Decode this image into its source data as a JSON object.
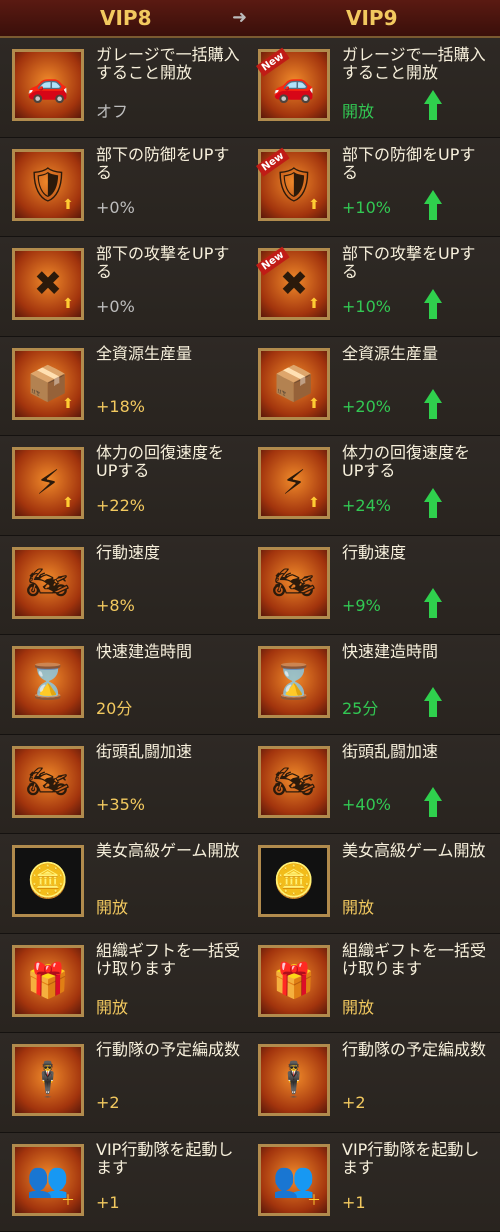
{
  "header": {
    "left_label": "VIP8",
    "arrow_icon": "arrow-right-icon",
    "right_label": "VIP9"
  },
  "rows": [
    {
      "title": "ガレージで一括購入すること開放",
      "icon": "car-icon",
      "left_value": "オフ",
      "right_value": "開放",
      "right_new": "New",
      "increase": true
    },
    {
      "title": "部下の防御をUPする",
      "icon": "shield-icon",
      "left_value": "+0%",
      "right_value": "+10%",
      "right_new": "New",
      "increase": true
    },
    {
      "title": "部下の攻撃をUPする",
      "icon": "guns-icon",
      "left_value": "+0%",
      "right_value": "+10%",
      "right_new": "New",
      "increase": true
    },
    {
      "title": "全資源生産量",
      "icon": "resource-crate-icon",
      "left_value": "+18%",
      "right_value": "+20%",
      "increase": true
    },
    {
      "title": "体力の回復速度をUPする",
      "icon": "lightning-icon",
      "left_value": "+22%",
      "right_value": "+24%",
      "increase": true
    },
    {
      "title": "行動速度",
      "icon": "motorcycle-icon",
      "left_value": "+8%",
      "right_value": "+9%",
      "increase": true
    },
    {
      "title": "快速建造時間",
      "icon": "hourglass-icon",
      "left_value": "20分",
      "right_value": "25分",
      "increase": true
    },
    {
      "title": "街頭乱闘加速",
      "icon": "motorbike-rider-icon",
      "left_value": "+35%",
      "right_value": "+40%",
      "increase": true
    },
    {
      "title": "美女高級ゲーム開放",
      "icon": "gold-chips-icon",
      "left_value": "開放",
      "right_value": "開放",
      "increase": false
    },
    {
      "title": "組織ギフトを一括受け取ります",
      "icon": "gift-box-icon",
      "left_value": "開放",
      "right_value": "開放",
      "increase": false
    },
    {
      "title": "行動隊の予定編成数",
      "icon": "mobster-icon",
      "left_value": "+2",
      "right_value": "+2",
      "increase": false
    },
    {
      "title": "VIP行動隊を起動します",
      "icon": "women-squad-icon",
      "left_value": "+1",
      "right_value": "+1",
      "increase": false
    }
  ]
}
